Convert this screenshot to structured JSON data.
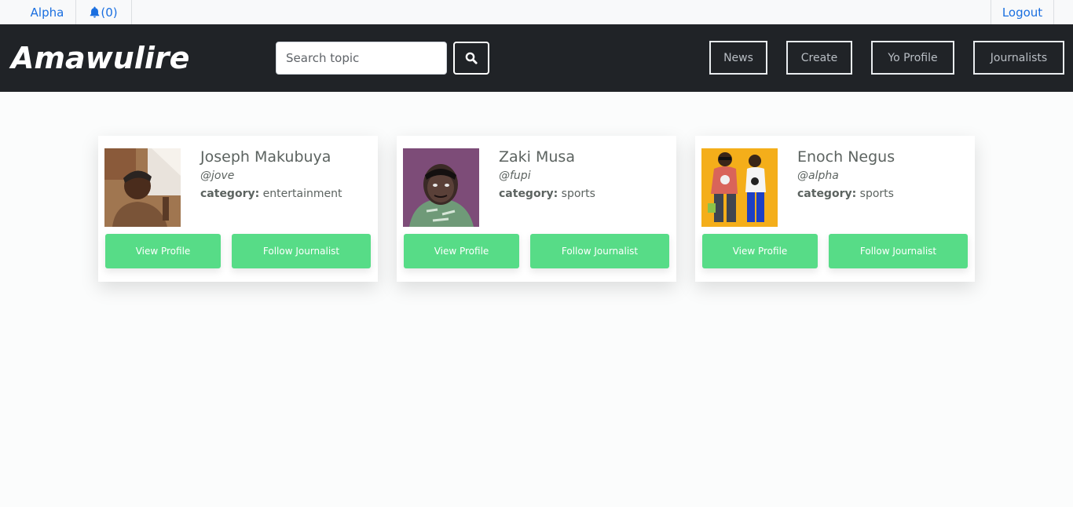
{
  "topbar": {
    "user": "Alpha",
    "notifications": "(0)",
    "logout": "Logout"
  },
  "navbar": {
    "brand": "Amawulire",
    "search_placeholder": "Search topic",
    "links": [
      "News",
      "Create",
      "Yo Profile",
      "Journalists"
    ]
  },
  "journalists": [
    {
      "name": "Joseph Makubuya",
      "handle": "@jove",
      "category_label": "category:",
      "category": "entertainment"
    },
    {
      "name": "Zaki Musa",
      "handle": "@fupi",
      "category_label": "category:",
      "category": "sports"
    },
    {
      "name": "Enoch Negus",
      "handle": "@alpha",
      "category_label": "category:",
      "category": "sports"
    }
  ],
  "card_actions": {
    "view": "View Profile",
    "follow": "Follow Journalist"
  },
  "colors": {
    "navbar_bg": "#202327",
    "link_blue": "#1a6fe0",
    "button_green": "#57dc87"
  },
  "icons": {
    "notifications": "bell-icon",
    "search": "search-icon"
  }
}
